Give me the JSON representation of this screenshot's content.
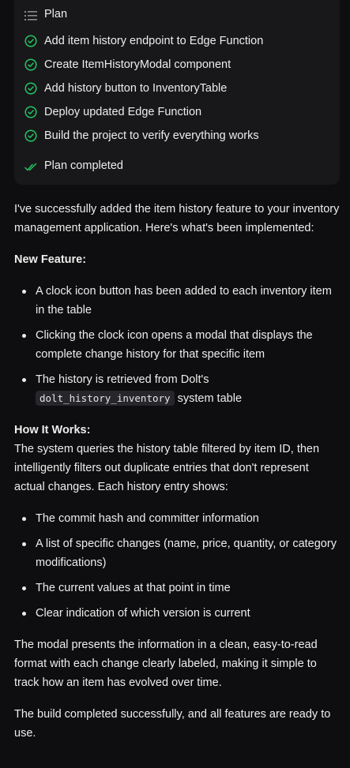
{
  "plan": {
    "title": "Plan",
    "items": [
      {
        "label": "Add item history endpoint to Edge Function",
        "status": "done"
      },
      {
        "label": "Create ItemHistoryModal component",
        "status": "done"
      },
      {
        "label": "Add history button to InventoryTable",
        "status": "done"
      },
      {
        "label": "Deploy updated Edge Function",
        "status": "done"
      },
      {
        "label": "Build the project to verify everything works",
        "status": "done"
      }
    ],
    "completed_label": "Plan completed",
    "colors": {
      "check": "#22c55e",
      "card_bg": "#18181b"
    }
  },
  "message": {
    "intro": "I've successfully added the item history feature to your inventory management application. Here's what's been implemented:",
    "new_feature_heading": "New Feature:",
    "new_feature_items": [
      "A clock icon button has been added to each inventory item in the table",
      "Clicking the clock icon opens a modal that displays the complete change history for that specific item"
    ],
    "history_item_prefix": "The history is retrieved from Dolt's",
    "history_item_code": "dolt_history_inventory",
    "history_item_suffix": "system table",
    "how_heading": "How It Works:",
    "how_text": "The system queries the history table filtered by item ID, then intelligently filters out duplicate entries that don't represent actual changes. Each history entry shows:",
    "how_items": [
      "The commit hash and committer information",
      "A list of specific changes (name, price, quantity, or category modifications)",
      "The current values at that point in time",
      "Clear indication of which version is current"
    ],
    "modal_text": "The modal presents the information in a clean, easy-to-read format with each change clearly labeled, making it simple to track how an item has evolved over time.",
    "build_text": "The build completed successfully, and all features are ready to use."
  }
}
